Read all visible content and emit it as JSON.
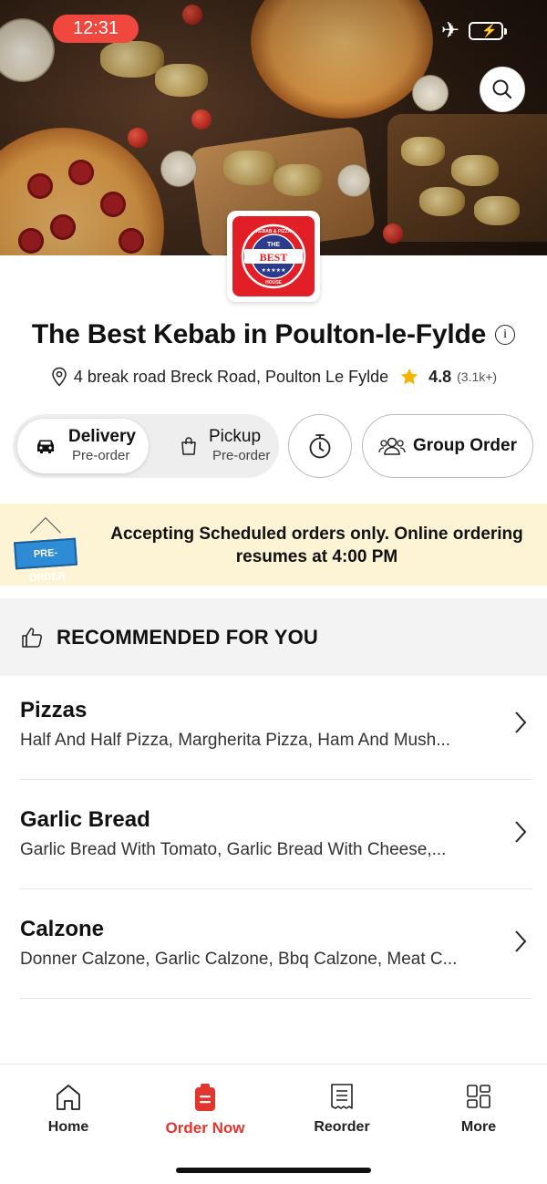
{
  "status_bar": {
    "time": "12:31"
  },
  "restaurant": {
    "logo_text": [
      "KEBAB & PIZZA",
      "THE",
      "BEST",
      "HOUSE"
    ],
    "name": "The Best Kebab in Poulton-le-Fylde",
    "address": "4 break road Breck Road, Poulton Le Fylde",
    "rating": "4.8",
    "rating_count": "(3.1k+)"
  },
  "order_mode": {
    "delivery": {
      "label": "Delivery",
      "sub": "Pre-order"
    },
    "pickup": {
      "label": "Pickup",
      "sub": "Pre-order"
    },
    "group_order": "Group Order"
  },
  "banner": {
    "sign": "PRE-ORDER",
    "message": "Accepting Scheduled orders only. Online ordering resumes at 4:00 PM"
  },
  "recommended": {
    "title": "RECOMMENDED FOR YOU"
  },
  "categories": [
    {
      "name": "Pizzas",
      "items": "Half And Half Pizza, Margherita Pizza, Ham And Mush..."
    },
    {
      "name": "Garlic Bread",
      "items": "Garlic Bread With Tomato, Garlic Bread With Cheese,..."
    },
    {
      "name": "Calzone",
      "items": "Donner Calzone, Garlic Calzone, Bbq Calzone, Meat C..."
    }
  ],
  "nav": [
    {
      "label": "Home",
      "icon": "home-icon"
    },
    {
      "label": "Order Now",
      "icon": "order-bag-icon"
    },
    {
      "label": "Reorder",
      "icon": "receipt-icon"
    },
    {
      "label": "More",
      "icon": "grid-icon"
    }
  ],
  "colors": {
    "accent": "#e2352d",
    "banner_bg": "#fcf4d4",
    "rating_star": "#f5b400"
  }
}
